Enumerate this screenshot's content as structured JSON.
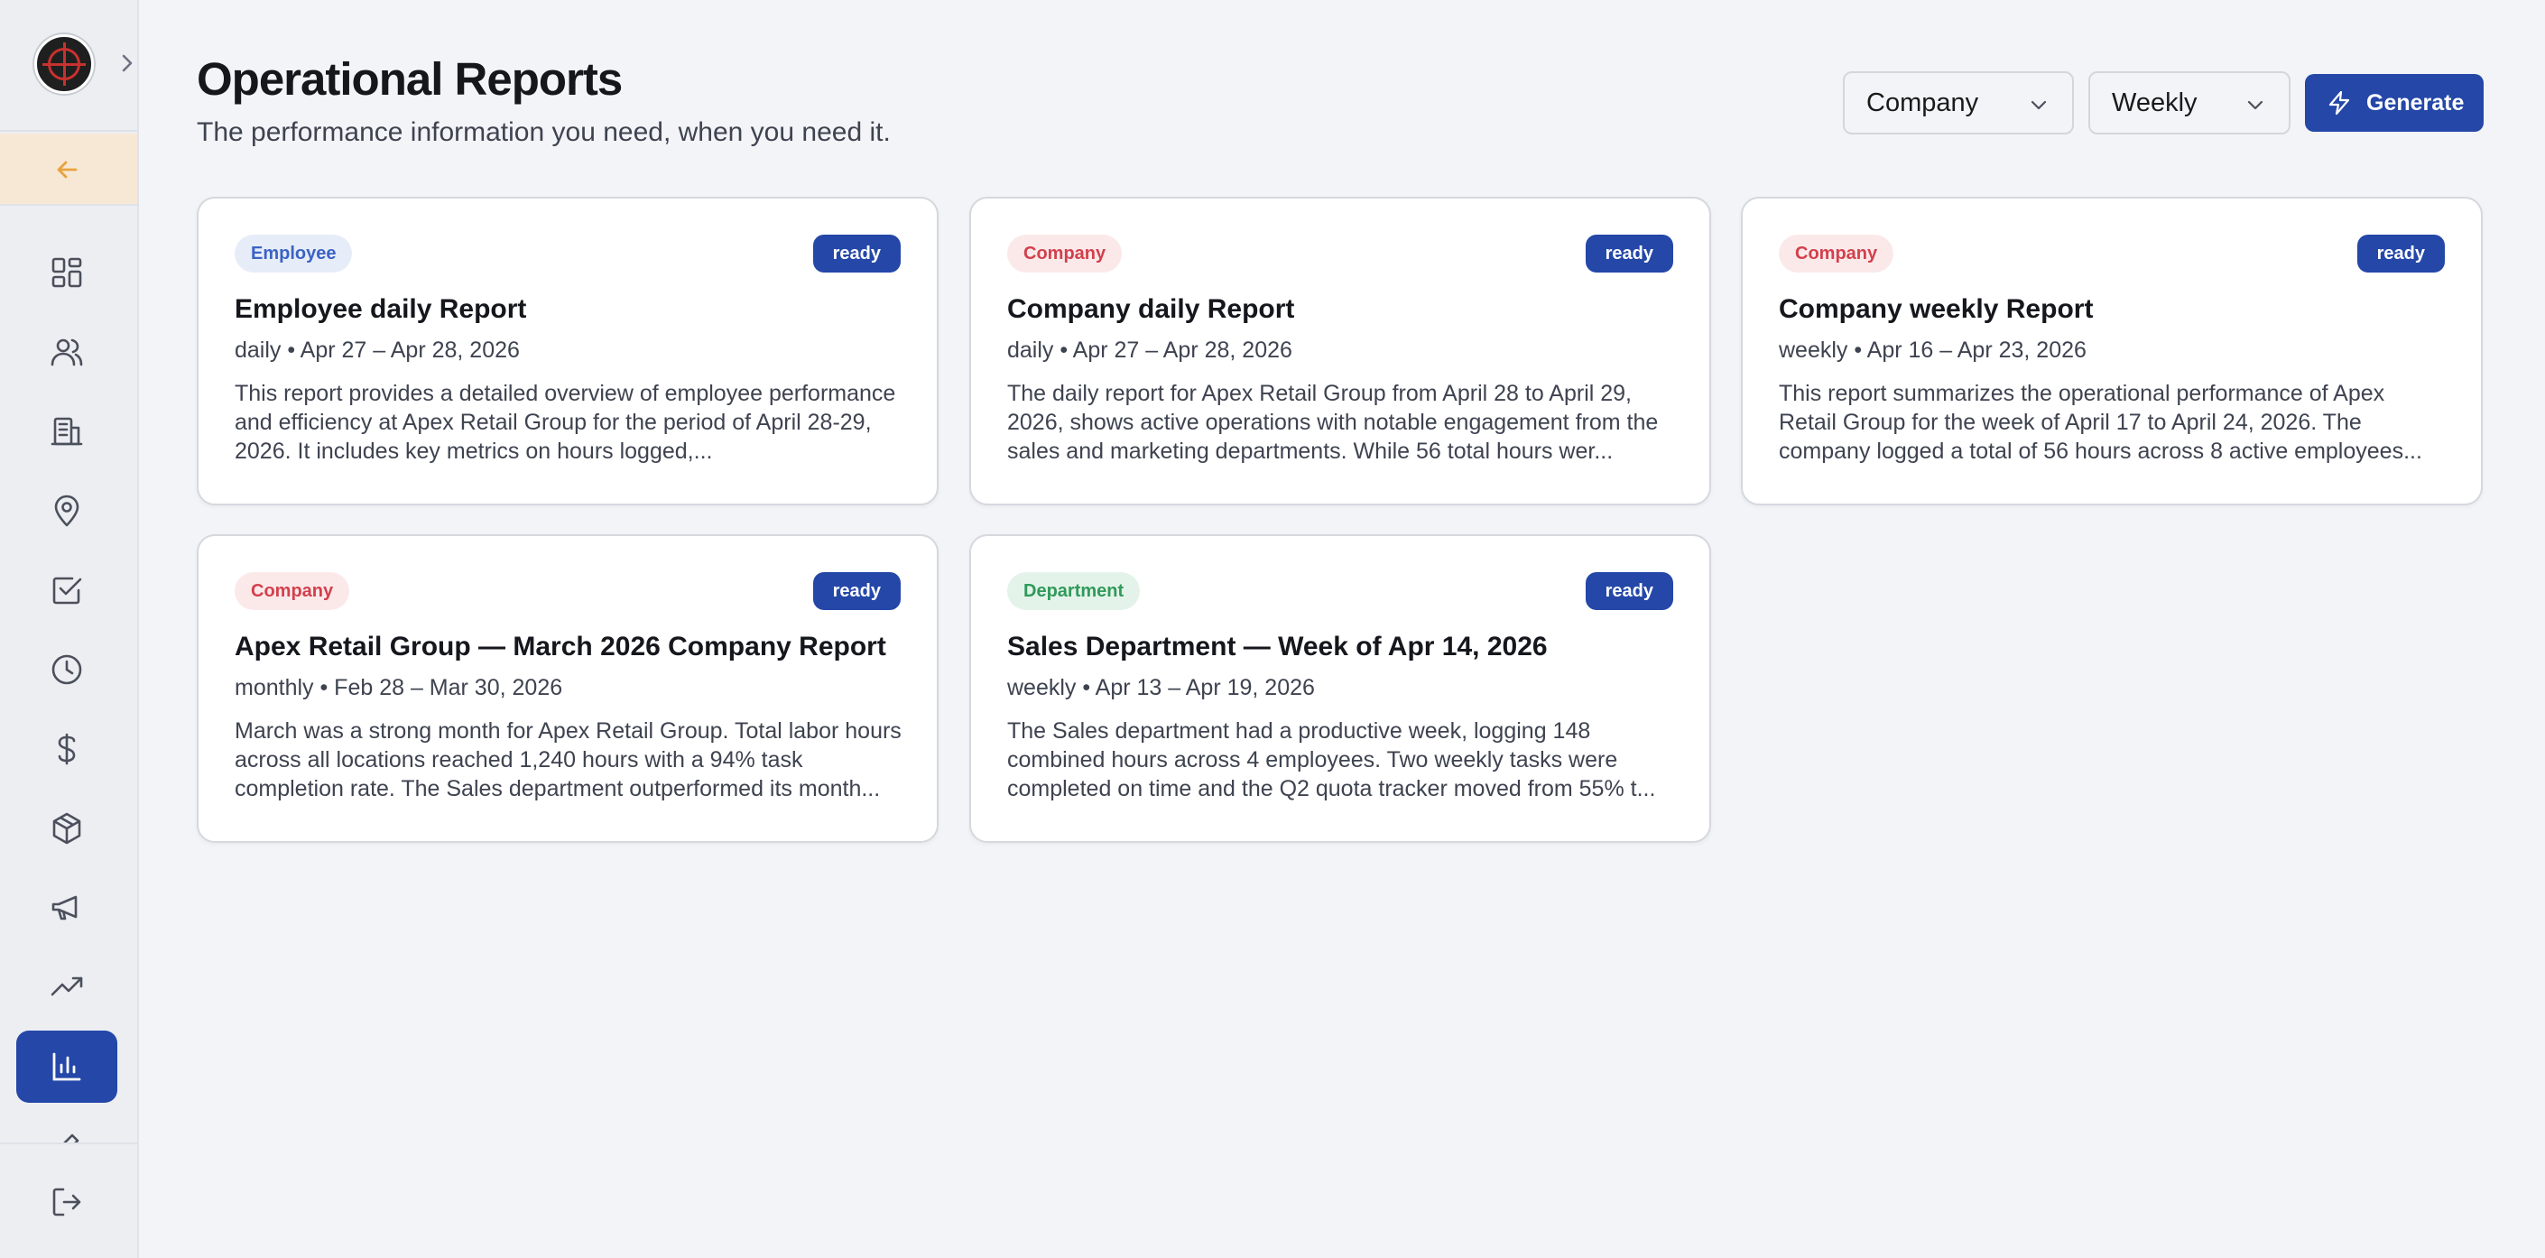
{
  "header": {
    "title": "Operational Reports",
    "subtitle": "The performance information you need, when you need it."
  },
  "filters": {
    "scope_value": "Company",
    "period_value": "Weekly",
    "generate_label": "Generate"
  },
  "sidebar": {
    "icons": [
      "dashboard-icon",
      "users-icon",
      "building-icon",
      "location-pin-icon",
      "task-check-icon",
      "clock-icon",
      "dollar-icon",
      "package-icon",
      "megaphone-icon",
      "trending-up-icon",
      "bar-chart-icon",
      "edit-icon"
    ],
    "active": "bar-chart-icon",
    "logout_icon": "logout-icon"
  },
  "colors": {
    "primary": "#2447a8",
    "back_row_bg": "#f7e8d6",
    "back_arrow": "#e8a33d",
    "employee_tag": "#3b63c4",
    "company_tag": "#d2404c",
    "department_tag": "#2f9a5a"
  },
  "reports": [
    {
      "tag": "Employee",
      "status": "ready",
      "title": "Employee daily Report",
      "meta": "daily • Apr 27 – Apr 28, 2026",
      "description": "This report provides a detailed overview of employee performance and efficiency at Apex Retail Group for the period of April 28-29, 2026. It includes key metrics on hours logged,..."
    },
    {
      "tag": "Company",
      "status": "ready",
      "title": "Company daily Report",
      "meta": "daily • Apr 27 – Apr 28, 2026",
      "description": "The daily report for Apex Retail Group from April 28 to April 29, 2026, shows active operations with notable engagement from the sales and marketing departments. While 56 total hours wer..."
    },
    {
      "tag": "Company",
      "status": "ready",
      "title": "Company weekly Report",
      "meta": "weekly • Apr 16 – Apr 23, 2026",
      "description": "This report summarizes the operational performance of Apex Retail Group for the week of April 17 to April 24, 2026. The company logged a total of 56 hours across 8 active employees..."
    },
    {
      "tag": "Company",
      "status": "ready",
      "title": "Apex Retail Group — March 2026 Company Report",
      "meta": "monthly • Feb 28 – Mar 30, 2026",
      "description": "March was a strong month for Apex Retail Group. Total labor hours across all locations reached 1,240 hours with a 94% task completion rate. The Sales department outperformed its month..."
    },
    {
      "tag": "Department",
      "status": "ready",
      "title": "Sales Department — Week of Apr 14, 2026",
      "meta": "weekly • Apr 13 – Apr 19, 2026",
      "description": "The Sales department had a productive week, logging 148 combined hours across 4 employees. Two weekly tasks were completed on time and the Q2 quota tracker moved from 55% t..."
    }
  ]
}
